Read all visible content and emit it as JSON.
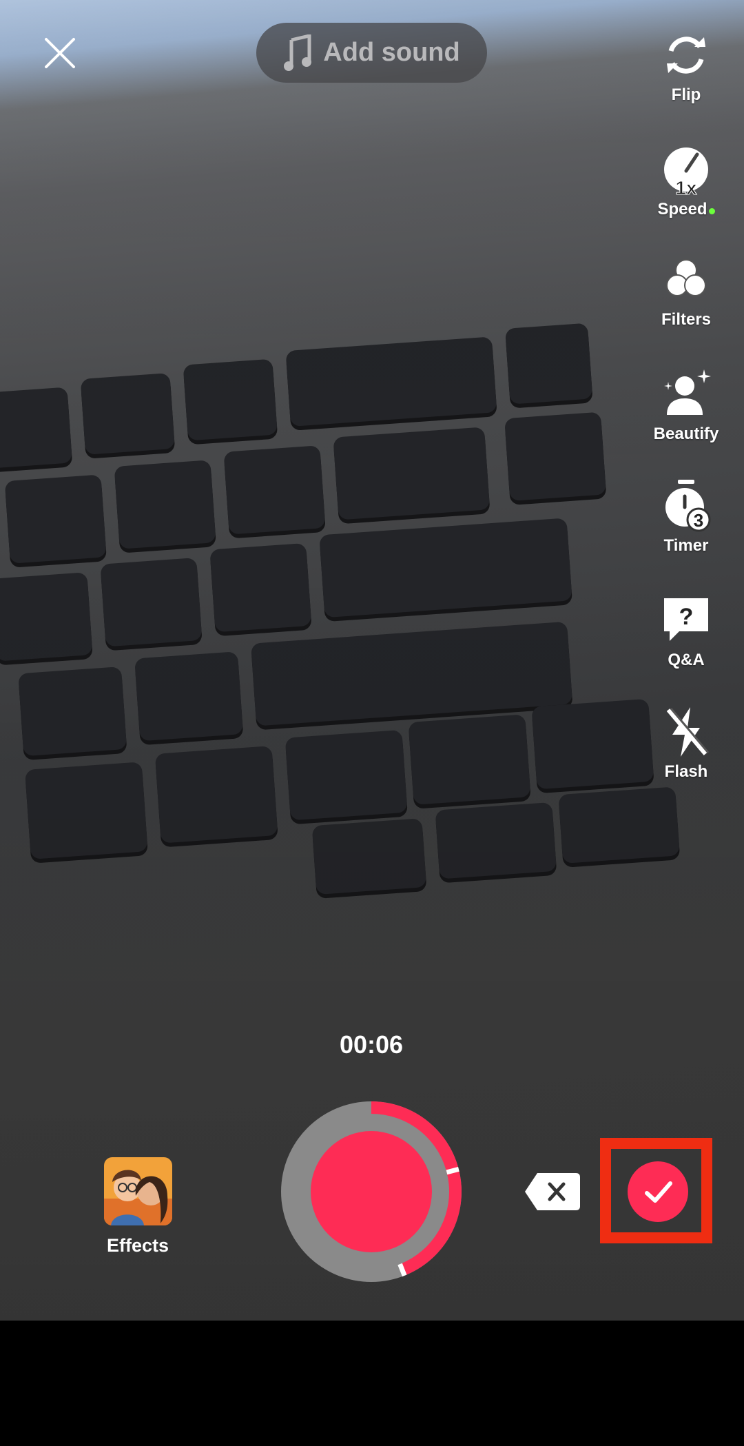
{
  "top": {
    "close_icon": "close-icon",
    "add_sound_label": "Add sound",
    "music_icon": "music-note-icon"
  },
  "side_tools": [
    {
      "label": "Flip",
      "icon": "flip-camera-icon"
    },
    {
      "label": "Speed",
      "icon": "speed-gauge-icon",
      "badge": "1x"
    },
    {
      "label": "Filters",
      "icon": "filters-icon"
    },
    {
      "label": "Beautify",
      "icon": "beautify-icon"
    },
    {
      "label": "Timer",
      "icon": "timer-icon",
      "badge": "3"
    },
    {
      "label": "Q&A",
      "icon": "qa-icon",
      "badge": "?"
    },
    {
      "label": "Flash",
      "icon": "flash-off-icon"
    }
  ],
  "recording": {
    "elapsed": "00:06",
    "progress": 0.44,
    "segment_marks": [
      0.21,
      0.44
    ]
  },
  "bottom": {
    "effects_label": "Effects",
    "delete_icon": "delete-segment-icon",
    "confirm_icon": "checkmark-icon"
  },
  "colors": {
    "accent": "#fe2c55",
    "highlight": "#ef2d12",
    "ring": "#8a8a8a"
  }
}
